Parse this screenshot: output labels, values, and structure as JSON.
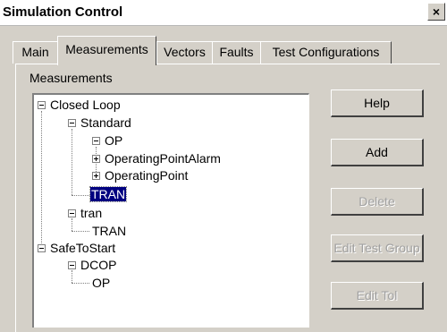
{
  "window": {
    "title": "Simulation Control",
    "close_glyph": "×"
  },
  "tabs": [
    {
      "label": "Main",
      "active": false
    },
    {
      "label": "Measurements",
      "active": true
    },
    {
      "label": "Vectors",
      "active": false
    },
    {
      "label": "Faults",
      "active": false
    },
    {
      "label": "Test Configurations",
      "active": false
    }
  ],
  "group_label": "Measurements",
  "tree": {
    "nodes": [
      {
        "label": "Closed Loop",
        "state": "expanded"
      },
      {
        "label": "Standard",
        "state": "expanded"
      },
      {
        "label": "OP",
        "state": "expanded"
      },
      {
        "label": "OperatingPointAlarm",
        "state": "collapsed"
      },
      {
        "label": "OperatingPoint",
        "state": "collapsed"
      },
      {
        "label": "TRAN",
        "state": "leaf",
        "selected": true
      },
      {
        "label": "tran",
        "state": "expanded"
      },
      {
        "label": "TRAN",
        "state": "leaf"
      },
      {
        "label": "SafeToStart",
        "state": "expanded"
      },
      {
        "label": "DCOP",
        "state": "expanded"
      },
      {
        "label": "OP",
        "state": "leaf"
      }
    ]
  },
  "buttons": [
    {
      "label": "Help",
      "enabled": true
    },
    {
      "label": "Add",
      "enabled": true
    },
    {
      "label": "Delete",
      "enabled": false
    },
    {
      "label": "Edit Test Group",
      "enabled": false
    },
    {
      "label": "Edit Tol",
      "enabled": false
    }
  ],
  "colors": {
    "face": "#d4d0c8",
    "selection": "#000080",
    "disabled_text": "#a0a0a0"
  }
}
